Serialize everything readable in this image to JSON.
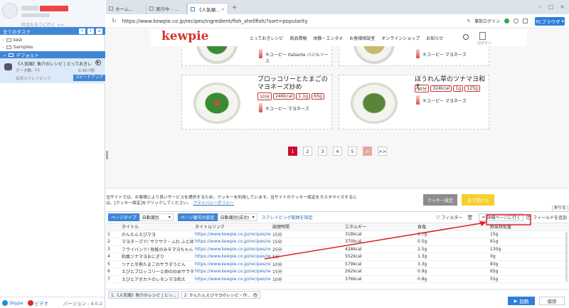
{
  "left_panel": {
    "back_link": "料金を払うに行く >>",
    "tasks_header": "全てのタスク",
    "folders": [
      {
        "name": "test"
      },
      {
        "name": "Samples"
      }
    ],
    "group": "デフォルト",
    "task": {
      "title": "《人気順》魚介のレシピ | とっておきレシ…",
      "data_label": "データ数:",
      "data_count": "11",
      "elapsed": "0:30:7秒",
      "mode": "高速スクレイピング",
      "speedup": "スピードアップ"
    },
    "footer": {
      "skype": "Skype",
      "video": "ビデオ",
      "version": "バージョン : 4.0.2"
    }
  },
  "browser": {
    "tabs": [
      {
        "label": "ホーム..."
      },
      {
        "label": "実行中 - ..."
      },
      {
        "label": "《人気順..."
      }
    ],
    "url": "https://www.kewpie.co.jp/recipes/ingredient/fish_shellfish/?sort=popularity",
    "login_label": "事前ログイン",
    "browser_mode": "PCブラウザ"
  },
  "site": {
    "logo": "kewpie",
    "nav": [
      "とっておきレシピ",
      "商品情報",
      "体験・エンタメ",
      "お客様相談室",
      "オンラインショップ",
      "お知らせ"
    ],
    "login": "ログイン",
    "top_cards": [
      {
        "product": "キユーピー Italiante バジルソース"
      },
      {
        "product": "キユーピー マヨネーズ"
      }
    ],
    "cards": [
      {
        "title": "ブロッコリーとたまごのマヨネーズ炒め",
        "time": "10分",
        "kcal": "246kcal",
        "salt": "1.1g",
        "veg": "65g",
        "product": "キユーピー マヨネーズ"
      },
      {
        "title": "ほうれん草のツナマヨ和え",
        "time": "10分",
        "kcal": "324kcal",
        "salt": "1g",
        "veg": "125g",
        "product": "キユーピー マヨネーズ"
      }
    ],
    "pages": [
      "1",
      "2",
      "3",
      "4",
      "5",
      ">",
      ">>"
    ],
    "cookie_text": "当サイトでは、お客様により良いサービスを提供するため、クッキーを利用しています。当サイトのクッキー設定をカスタマイズするには、[クッキー設定]をクリックしてください。",
    "cookie_link": "プライバシーポリシー",
    "cookie_settings": "クッキー設定",
    "cookie_accept": "全て受け入"
  },
  "data_panel": {
    "collapse": "折りる",
    "page_type_label": "ページタイプ",
    "page_type_value": "自動識別",
    "page_num_label": "ページ番号の設定",
    "page_num_value": "自動識別(成功)",
    "scrape_range": "スクレイピング範囲を指定",
    "filter": "フィルター",
    "goto_detail": "詳細ページに行く",
    "add_field": "フィールドを追加",
    "columns": [
      "タイトル",
      "タイトルリンク",
      "調理時間",
      "エネルギー",
      "食塩",
      "野菜摂取量"
    ],
    "rows": [
      [
        "1",
        "かんたんえびマヨ",
        "https://www.kewpie.co.jp/recipes/recipe/QP...",
        "15分",
        "318kcal",
        "1.7g",
        "15g"
      ],
      [
        "2",
        "マヨネーズで! サクサク・ふわ ふと卵野菜の...",
        "https://www.kewpie.co.jp/recipes/recipe/QP...",
        "15分",
        "370kcal",
        "0.5g",
        "61g"
      ],
      [
        "3",
        "フライパンで! 秋鮭のみそマヨちゃんちゃ...",
        "https://www.kewpie.co.jp/recipes/recipe/QP...",
        "25分",
        "428kcal",
        "2.5g",
        "130g"
      ],
      [
        "4",
        "和風ツナマヨおにぎり",
        "https://www.kewpie.co.jp/recipes/recipe/QP...",
        "5分",
        "552kcal",
        "1.3g",
        "0g"
      ],
      [
        "5",
        "ツナと半熟たまごのサラダうどん",
        "https://www.kewpie.co.jp/recipes/recipe/QP...",
        "10分",
        "579kcal",
        "3.3g",
        "83g"
      ],
      [
        "6",
        "えびとブロッコリーと卵の炒めサラダ",
        "https://www.kewpie.co.jp/recipes/recipe/QP...",
        "15分",
        "262kcal",
        "0.9g",
        "65g"
      ],
      [
        "7",
        "えびとアボカドのレモンマヨ和え",
        "https://www.kewpie.co.jp/recipes/recipe/QP...",
        "10分",
        "376kcal",
        "0.8g",
        "55g"
      ]
    ],
    "bottom_tabs": [
      "1.《人気順》魚介のレシピ | とっ...",
      "2. かんたんえびマヨのレシピ・作..."
    ],
    "start": "起動",
    "save": "保存"
  }
}
